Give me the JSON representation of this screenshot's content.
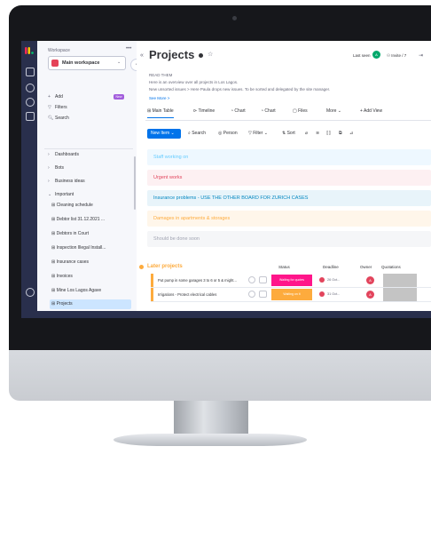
{
  "sidebar": {
    "workspace_label": "Workspace",
    "workspace_dots": "•••",
    "workspace_name": "Main workspace",
    "top_items": [
      {
        "icon": "+",
        "label": "Add"
      },
      {
        "icon": "▽",
        "label": "Filters"
      },
      {
        "icon": "🔍︎",
        "label": "Search"
      }
    ],
    "new_badge": "New",
    "nav_items": [
      {
        "icon": "›",
        "label": "Dashboards"
      },
      {
        "icon": "›",
        "label": "Bots"
      },
      {
        "icon": "›",
        "label": "Business ideas"
      },
      {
        "icon": "⌄",
        "label": "Important"
      }
    ],
    "boards": [
      {
        "label": "Cleaning schedule",
        "active": false
      },
      {
        "label": "Debtor list 31.12.2021 ...",
        "active": false
      },
      {
        "label": "Debtors in Court",
        "active": false
      },
      {
        "label": "Inspection Illegal Install...",
        "active": false
      },
      {
        "label": "Insurance cases",
        "active": false
      },
      {
        "label": "Invoices",
        "active": false
      },
      {
        "label": "Mine Los Lagos Agave",
        "active": false
      },
      {
        "label": "Projects",
        "active": true
      }
    ]
  },
  "header": {
    "title": "Projects",
    "last_seen": "Last seen",
    "last_seen_avatar": "A",
    "invite": "Invite / 7",
    "desc_lines": [
      "READ THEM",
      "Here is an overview over all projects in Los Lagos.",
      "New unsorted issues > Here Paula drops new issues. To be sorted and delegated by the site manager."
    ],
    "see_more": "See More >"
  },
  "tabs": [
    {
      "label": "Main Table"
    },
    {
      "label": "Timeline"
    },
    {
      "label": "Chart"
    },
    {
      "label": "Chart"
    },
    {
      "label": "Files"
    },
    {
      "label": "More ⌄"
    },
    {
      "label": "+ Add View"
    }
  ],
  "toolbar": {
    "new_item": "New Item  ⌄",
    "tools": [
      "Search",
      "Person",
      "Filter ⌄",
      "Sort",
      "⌀",
      "≋",
      "⟦⟧",
      "⧉",
      "⊿"
    ]
  },
  "groups": [
    {
      "label": "Staff working on",
      "color": "#66ccff",
      "bg": "#eef8ff"
    },
    {
      "label": "Urgent works",
      "color": "#e2445c",
      "bg": "#fdf0f2"
    },
    {
      "label": "Insurance problems - USE THE OTHER BOARD FOR ZURICH CASES",
      "color": "#0086c0",
      "bg": "#e8f4fa"
    },
    {
      "label": "Damages in apartments & storages",
      "color": "#fdab3d",
      "bg": "#fff6ea"
    },
    {
      "label": "Should be done soon",
      "color": "#a0a3b1",
      "bg": "#f5f6f8"
    }
  ],
  "later_projects": {
    "title": "Later projects",
    "columns": [
      "Status",
      "Deadline",
      "Owner",
      "Quotations"
    ],
    "rows": [
      {
        "name": "Put pump in some garages 3 to 6 or 5 & might...",
        "status": "Waiting for quotes",
        "status_color": "#ff158a",
        "deadline": "26 Oct...",
        "owner": "A"
      },
      {
        "name": "Irrigations - Protect electrical cables",
        "status": "Waiting on it",
        "status_color": "#fdab3d",
        "deadline": "31 Oct...",
        "owner": "A"
      }
    ]
  }
}
